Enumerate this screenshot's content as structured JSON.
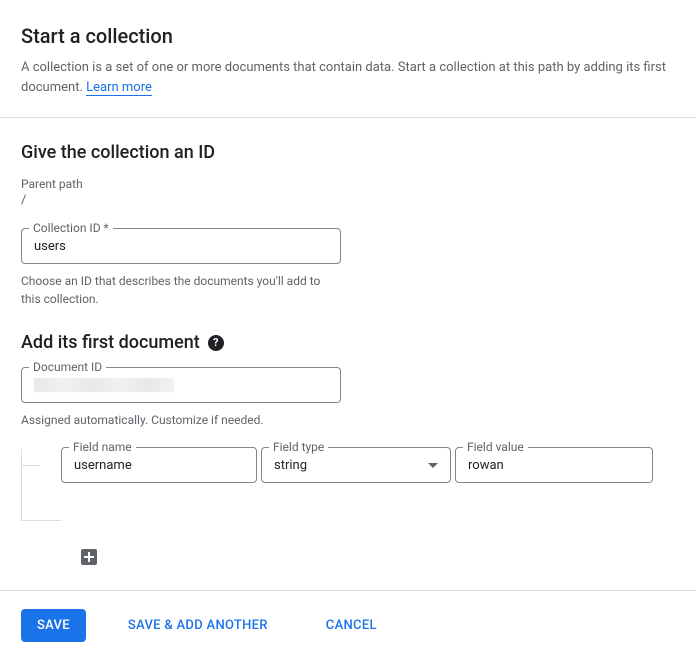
{
  "header": {
    "title": "Start a collection",
    "description": "A collection is a set of one or more documents that contain data. Start a collection at this path by adding its first document. ",
    "learn_more": "Learn more"
  },
  "collection": {
    "section_title": "Give the collection an ID",
    "parent_label": "Parent path",
    "parent_value": "/",
    "id_label": "Collection ID *",
    "id_value": "users",
    "helper": "Choose an ID that describes the documents you'll add to this collection."
  },
  "document": {
    "section_title": "Add its first document",
    "id_label": "Document ID",
    "helper": "Assigned automatically. Customize if needed.",
    "field_name_label": "Field name",
    "field_name_value": "username",
    "field_type_label": "Field type",
    "field_type_value": "string",
    "field_value_label": "Field value",
    "field_value_value": "rowan"
  },
  "footer": {
    "save": "SAVE",
    "save_another": "SAVE & ADD ANOTHER",
    "cancel": "CANCEL"
  }
}
